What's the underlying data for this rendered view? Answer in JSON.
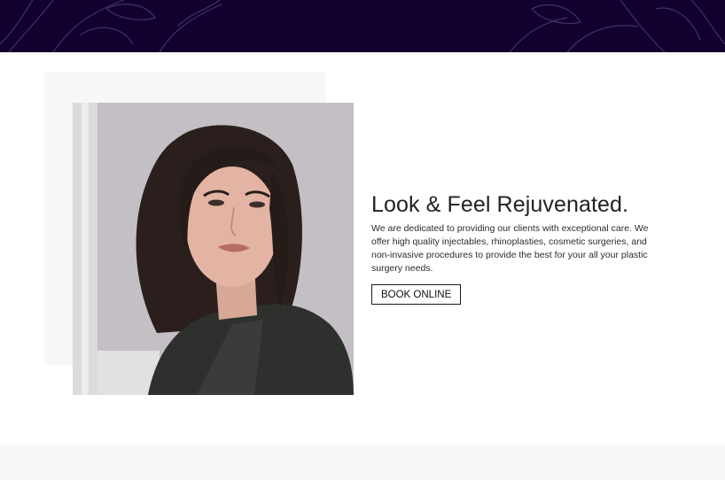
{
  "hero": {
    "headline": "Look & Feel Rejuvenated.",
    "description": "We are dedicated to providing our clients with exceptional care. We offer high quality injectables, rhinoplasties, cosmetic surgeries, and non-invasive procedures to provide the best for your all your plastic surgery needs.",
    "cta_label": "BOOK ONLINE"
  },
  "colors": {
    "banner_bg": "#12002e",
    "panel_bg": "#f7f7f7",
    "text": "#222222"
  },
  "icons": {
    "banner_decoration": "floral-line-art",
    "photo": "woman-portrait"
  }
}
